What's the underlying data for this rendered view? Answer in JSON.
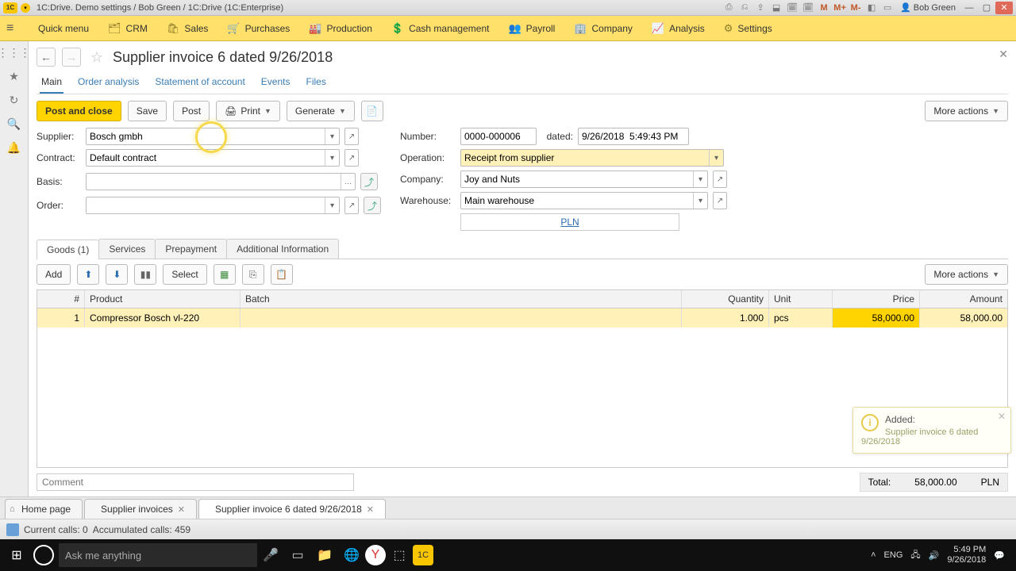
{
  "titlebar": {
    "title": "1C:Drive. Demo settings / Bob Green / 1C:Drive (1C:Enterprise)",
    "user": "Bob Green"
  },
  "topmenu": {
    "quick": "Quick menu",
    "items": [
      "CRM",
      "Sales",
      "Purchases",
      "Production",
      "Cash management",
      "Payroll",
      "Company",
      "Analysis",
      "Settings"
    ]
  },
  "page": {
    "title": "Supplier invoice 6 dated 9/26/2018",
    "subtabs": [
      "Main",
      "Order analysis",
      "Statement of account",
      "Events",
      "Files"
    ],
    "toolbar": {
      "post_close": "Post and close",
      "save": "Save",
      "post": "Post",
      "print": "Print",
      "generate": "Generate",
      "more": "More actions"
    },
    "fields": {
      "supplier_label": "Supplier:",
      "supplier": "Bosch gmbh",
      "contract_label": "Contract:",
      "contract": "Default contract",
      "basis_label": "Basis:",
      "basis": "",
      "order_label": "Order:",
      "order": "",
      "number_label": "Number:",
      "number": "0000-000006",
      "dated_label": "dated:",
      "dated": "9/26/2018  5:49:43 PM",
      "operation_label": "Operation:",
      "operation": "Receipt from supplier",
      "company_label": "Company:",
      "company": "Joy and Nuts",
      "warehouse_label": "Warehouse:",
      "warehouse": "Main warehouse",
      "currency": "PLN"
    },
    "innertabs": [
      "Goods (1)",
      "Services",
      "Prepayment",
      "Additional Information"
    ],
    "tbl_toolbar": {
      "add": "Add",
      "select": "Select",
      "more": "More actions"
    },
    "columns": {
      "num": "#",
      "product": "Product",
      "batch": "Batch",
      "qty": "Quantity",
      "unit": "Unit",
      "price": "Price",
      "amount": "Amount"
    },
    "row": {
      "num": "1",
      "product": "Compressor Bosch vl-220",
      "batch": "",
      "qty": "1.000",
      "unit": "pcs",
      "price": "58,000.00",
      "amount": "58,000.00"
    },
    "comment_placeholder": "Comment",
    "total_label": "Total:",
    "total_value": "58,000.00",
    "total_curr": "PLN"
  },
  "doctabs": {
    "home": "Home page",
    "t1": "Supplier invoices",
    "t2": "Supplier invoice 6 dated 9/26/2018"
  },
  "statusbar": {
    "calls": "Current calls: 0",
    "acc": "Accumulated calls: 459"
  },
  "notif": {
    "title": "Added:",
    "body": "Supplier invoice 6 dated 9/26/2018"
  },
  "taskbar": {
    "search": "Ask me anything",
    "lang": "ENG",
    "time": "5:49 PM",
    "date": "9/26/2018"
  }
}
